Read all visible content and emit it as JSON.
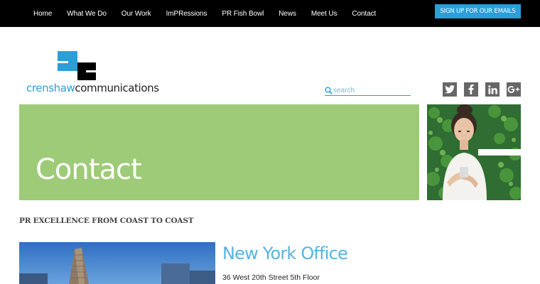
{
  "nav": {
    "items": [
      {
        "label": "Home"
      },
      {
        "label": "What We Do"
      },
      {
        "label": "Our Work"
      },
      {
        "label": "ImPRessions"
      },
      {
        "label": "PR Fish Bowl"
      },
      {
        "label": "News"
      },
      {
        "label": "Meet Us"
      },
      {
        "label": "Contact"
      }
    ],
    "signup_label": "SIGN UP FOR OUR EMAILS"
  },
  "logo": {
    "word_part1": "crenshaw",
    "word_part2": "communications"
  },
  "search": {
    "placeholder": "search",
    "icon": "search-icon"
  },
  "social": {
    "icons": [
      "twitter-icon",
      "facebook-icon",
      "linkedin-icon",
      "google-plus-icon"
    ]
  },
  "hero": {
    "title": "Contact"
  },
  "main": {
    "tagline": "PR EXCELLENCE FROM COAST TO COAST",
    "office": {
      "title": "New York Office",
      "address": "36 West 20th Street 5th Floor"
    }
  },
  "colors": {
    "accent_blue": "#2a9fd8",
    "hero_green": "#9ecb78",
    "topbar": "#000000",
    "social_grey": "#666666"
  }
}
